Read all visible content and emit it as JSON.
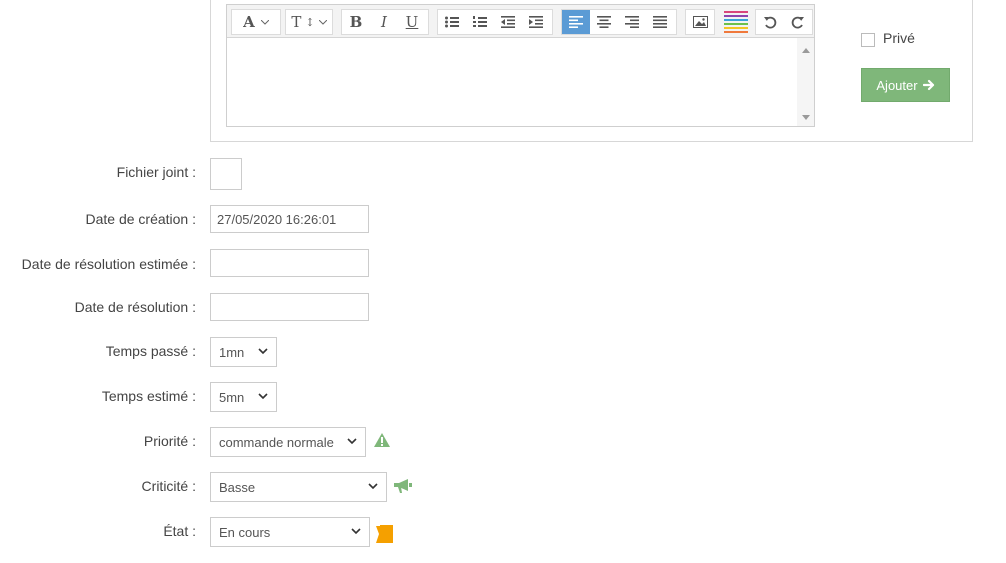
{
  "editor": {
    "toolbar": {
      "font_button": "A",
      "size_button": "T",
      "bold": "B",
      "italic": "I",
      "underline": "U"
    }
  },
  "prive": {
    "label": "Privé"
  },
  "ajouter": {
    "label": "Ajouter"
  },
  "form": {
    "fichier_joint": {
      "label": "Fichier joint :"
    },
    "date_creation": {
      "label": "Date de création :",
      "value": "27/05/2020 16:26:01"
    },
    "date_resolution_estimee": {
      "label": "Date de résolution estimée :",
      "value": ""
    },
    "date_resolution": {
      "label": "Date de résolution :",
      "value": ""
    },
    "temps_passe": {
      "label": "Temps passé :",
      "value": "1mn"
    },
    "temps_estime": {
      "label": "Temps estimé :",
      "value": "5mn"
    },
    "priorite": {
      "label": "Priorité :",
      "value": "commande normale",
      "icon": "warning-triangle-icon",
      "icon_color": "#7fb77a"
    },
    "criticite": {
      "label": "Criticité :",
      "value": "Basse",
      "icon": "megaphone-icon",
      "icon_color": "#7fb77a"
    },
    "etat": {
      "label": "État :",
      "value": "En cours",
      "icon": "flag-icon",
      "icon_color": "#f5a000"
    }
  },
  "colors": {
    "accent_active": "#5b9bd5",
    "button_green": "#7fb77a"
  }
}
